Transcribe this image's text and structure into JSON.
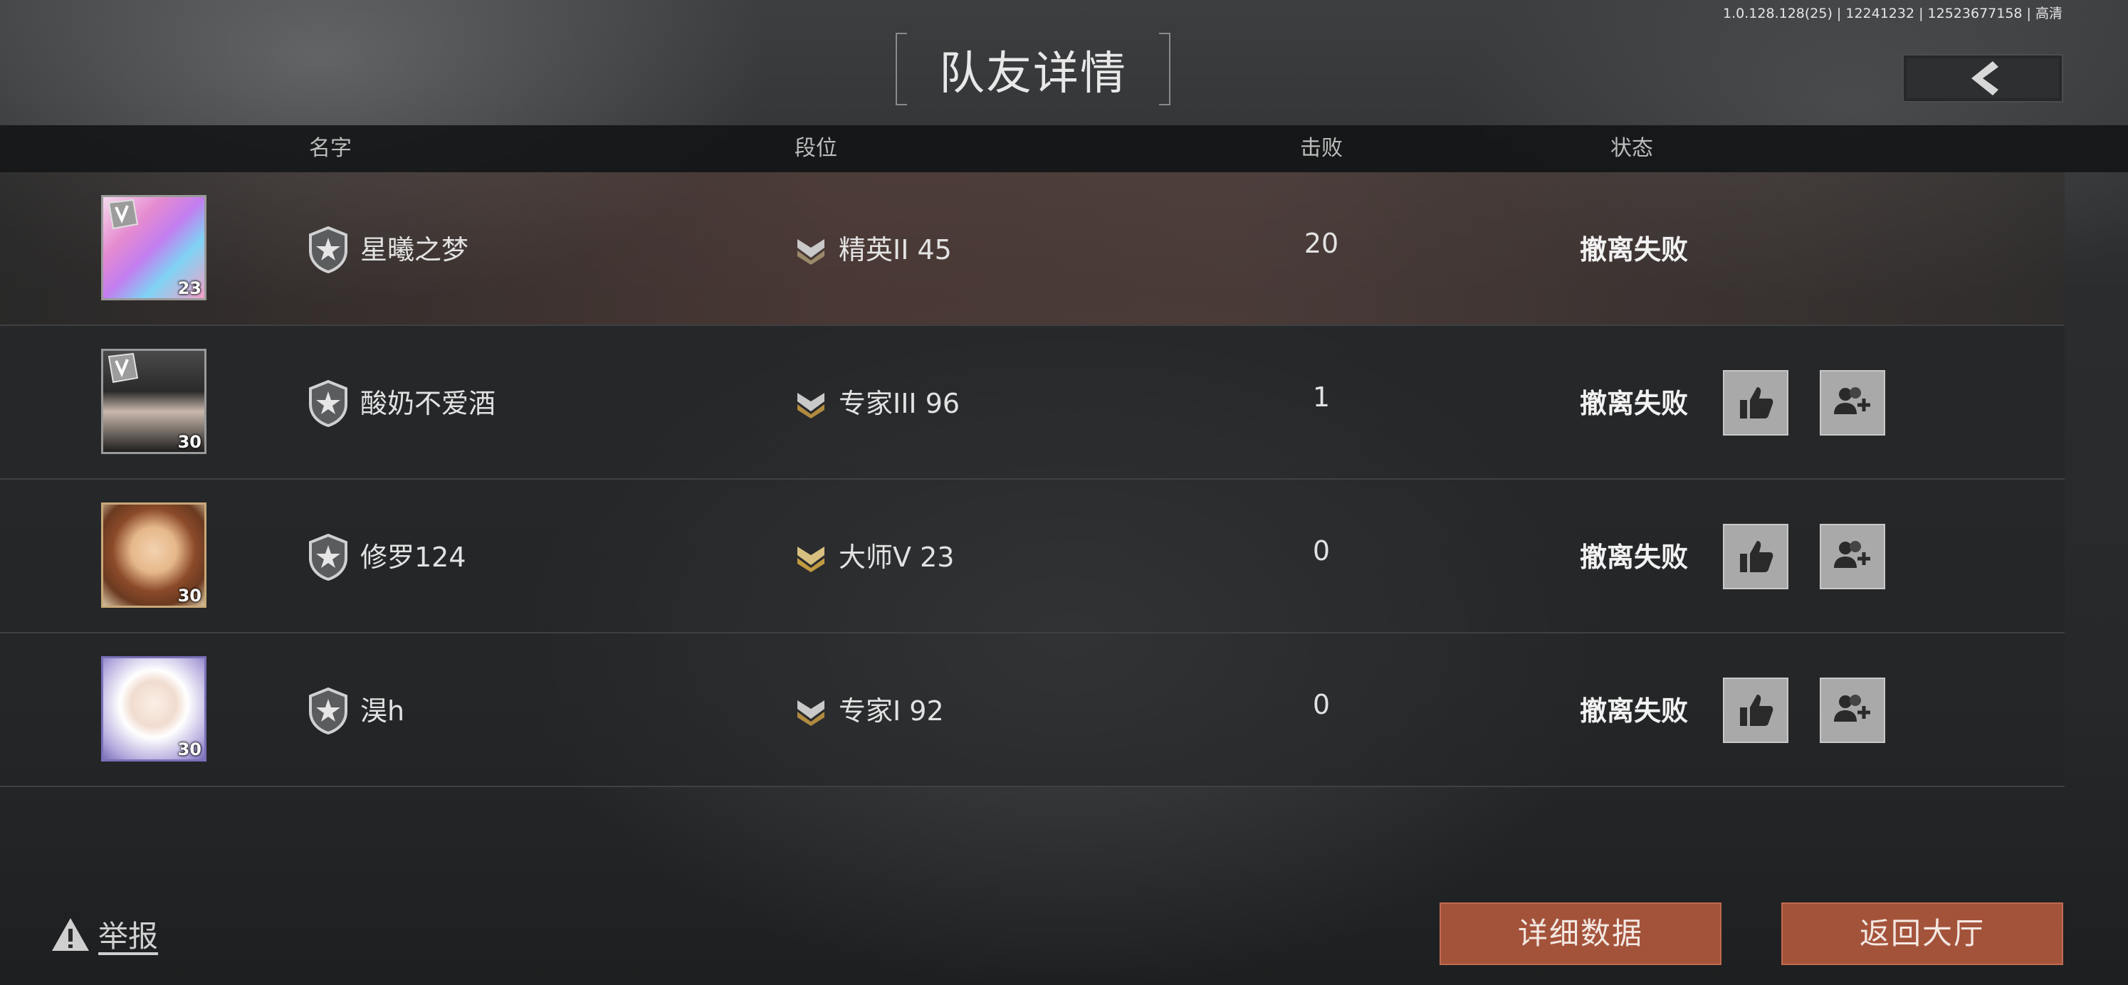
{
  "version": "1.0.128.128(25) | 12241232 | 12523677158 | 高清",
  "title": "队友详情",
  "columns": {
    "name": "名字",
    "rank": "段位",
    "kills": "击败",
    "status": "状态"
  },
  "players": [
    {
      "name": "星曦之梦",
      "rank": "精英II 45",
      "kills": "20",
      "status": "撤离失败",
      "level": "23",
      "avatar_style": "anime-pink",
      "self": true
    },
    {
      "name": "酸奶不爱酒",
      "rank": "专家III 96",
      "kills": "1",
      "status": "撤离失败",
      "level": "30",
      "avatar_style": "couple-photo",
      "self": false
    },
    {
      "name": "修罗124",
      "rank": "大师V 23",
      "kills": "0",
      "status": "撤离失败",
      "level": "30",
      "avatar_style": "pixel-boy",
      "self": false
    },
    {
      "name": "淏h",
      "rank": "专家I 92",
      "kills": "0",
      "status": "撤离失败",
      "level": "30",
      "avatar_style": "cartoon-cap",
      "self": false
    }
  ],
  "footer": {
    "report": "举报",
    "detail_button": "详细数据",
    "lobby_button": "返回大厅"
  },
  "colors": {
    "accent_button": "#a4533b",
    "status_text": "#f2f2f2",
    "action_button": "#a9a9a9"
  },
  "icons": {
    "back": "chevron-left-icon",
    "like": "thumbs-up-icon",
    "add_friend": "add-friend-icon",
    "report": "warning-icon",
    "player_badge": "star-shield-icon",
    "rank": "rank-chevron-icon"
  }
}
